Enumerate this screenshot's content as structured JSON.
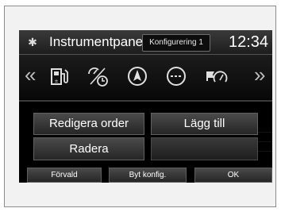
{
  "header": {
    "title": "Instrumentpanel",
    "config_label": "Konfigurering 1",
    "clock": "12:34",
    "settings_icon": "gear-icon"
  },
  "icon_row": {
    "left_arrow": "«",
    "right_arrow": "»",
    "icons": [
      "fuel-pump-info-icon",
      "fuel-economy-timer-icon",
      "navigation-compass-icon",
      "blank-display-icon",
      "speed-warning-icon"
    ]
  },
  "actions": {
    "reorder_label": "Redigera order",
    "add_label": "Lägg till",
    "delete_label": "Radera"
  },
  "bottom_bar": {
    "default_label": "Förvald",
    "switch_config_label": "Byt konfig.",
    "ok_label": "OK"
  },
  "colors": {
    "screen_bg": "#000000",
    "button_top": "#4a4a4a",
    "button_bottom": "#262626",
    "text": "#ffffff"
  }
}
